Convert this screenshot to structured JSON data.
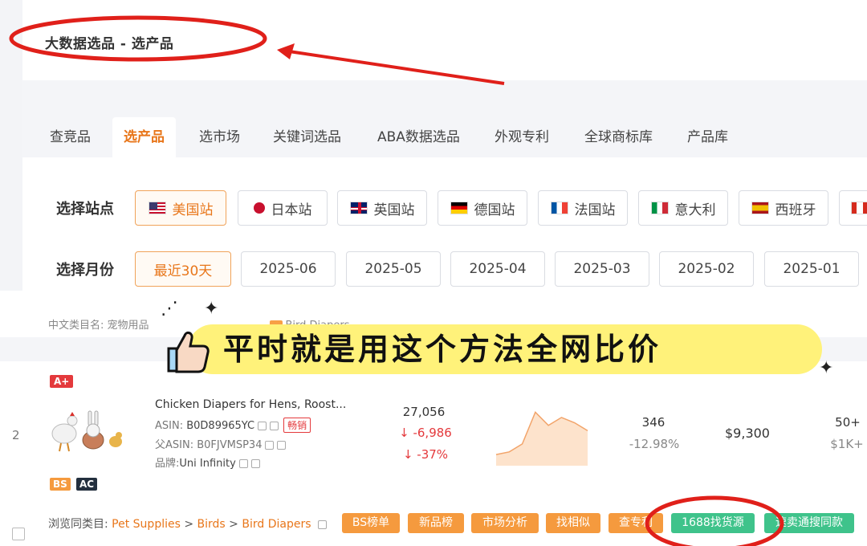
{
  "page": {
    "title": "大数据选品 - 选产品"
  },
  "tabs": [
    {
      "label": "查竞品",
      "active": false
    },
    {
      "label": "选产品",
      "active": true
    },
    {
      "label": "选市场",
      "active": false
    },
    {
      "label": "关键词选品",
      "active": false
    },
    {
      "label": "ABA数据选品",
      "active": false
    },
    {
      "label": "外观专利",
      "active": false
    },
    {
      "label": "全球商标库",
      "active": false
    },
    {
      "label": "产品库",
      "active": false
    }
  ],
  "filters": {
    "site_label": "选择站点",
    "sites": [
      {
        "label": "美国站",
        "flag": "us-flag",
        "active": true
      },
      {
        "label": "日本站",
        "flag": "jp-flag",
        "active": false
      },
      {
        "label": "英国站",
        "flag": "uk-flag",
        "active": false
      },
      {
        "label": "德国站",
        "flag": "de-flag",
        "active": false
      },
      {
        "label": "法国站",
        "flag": "fr-flag",
        "active": false
      },
      {
        "label": "意大利",
        "flag": "it-flag",
        "active": false
      },
      {
        "label": "西班牙",
        "flag": "es-flag",
        "active": false
      }
    ],
    "month_label": "选择月份",
    "months": [
      {
        "label": "最近30天",
        "active": true
      },
      {
        "label": "2025-06",
        "active": false
      },
      {
        "label": "2025-05",
        "active": false
      },
      {
        "label": "2025-04",
        "active": false
      },
      {
        "label": "2025-03",
        "active": false
      },
      {
        "label": "2025-02",
        "active": false
      },
      {
        "label": "2025-01",
        "active": false
      }
    ]
  },
  "breadcrumb": {
    "text": "中文类目名: 宠物用品",
    "tail": "Bird Diapers"
  },
  "banner": {
    "text": "平时就是用这个方法全网比价"
  },
  "product": {
    "grade": "A+",
    "index": "2",
    "title": "Chicken Diapers for Hens, Roost...",
    "asin_label": "ASIN:",
    "asin": "B0D89965YC",
    "hot_badge": "畅销",
    "parent_asin_label": "父ASIN:",
    "parent_asin": "B0FJVMSP34",
    "brand_label": "品牌:",
    "brand": "Uni Infinity",
    "sales": "27,056",
    "sales_change": "↓ -6,986",
    "sales_change_pct": "↓ -37%",
    "reviews": "346",
    "reviews_change": "-12.98%",
    "revenue": "$9,300",
    "sellers": "50+",
    "sellers_sub": "$1K+",
    "tag_bs": "BS",
    "tag_ac": "AC",
    "sparkline": [
      0.15,
      0.2,
      0.35,
      0.95,
      0.7,
      0.85,
      0.75,
      0.6
    ]
  },
  "category_row": {
    "label": "浏览同类目:",
    "path": [
      "Pet Supplies",
      "Birds",
      "Bird Diapers"
    ],
    "sep": ">",
    "buttons": [
      {
        "label": "BS榜单",
        "color": "orange"
      },
      {
        "label": "新品榜",
        "color": "orange"
      },
      {
        "label": "市场分析",
        "color": "orange"
      },
      {
        "label": "找相似",
        "color": "orange"
      },
      {
        "label": "查专利",
        "color": "orange"
      },
      {
        "label": "1688找货源",
        "color": "green"
      },
      {
        "label": "速卖通搜同款",
        "color": "green"
      }
    ]
  },
  "colors": {
    "accent": "#e8761a",
    "annotation": "#e0201a",
    "banner": "#fff27a"
  }
}
